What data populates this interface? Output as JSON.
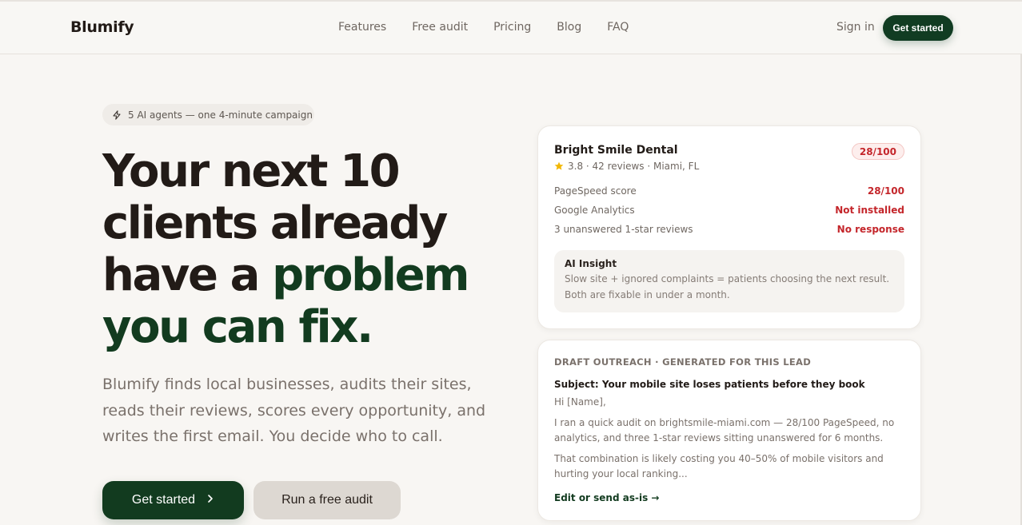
{
  "nav": {
    "logo": "Blumify",
    "links": [
      "Features",
      "Free audit",
      "Pricing",
      "Blog",
      "FAQ"
    ],
    "sign_in": "Sign in",
    "cta": "Get started"
  },
  "hero": {
    "badge": "5 AI agents — one 4-minute campaign",
    "headline_line1": "Your next 10",
    "headline_line2": "clients already",
    "headline_line3a": "have a ",
    "headline_line3b": "problem",
    "headline_line4": "you can fix.",
    "subcopy": "Blumify finds local businesses, audits their sites, reads their reviews, scores every opportunity, and writes the first email. You decide who to call.",
    "primary_button": "Get started",
    "secondary_button": "Run a free audit"
  },
  "lead_card": {
    "name": "Bright Smile Dental",
    "score": "28/100",
    "meta": "3.8 · 42 reviews · Miami, FL",
    "metrics": [
      {
        "label": "PageSpeed score",
        "value": "28/100"
      },
      {
        "label": "Google Analytics",
        "value": "Not installed"
      },
      {
        "label": "3 unanswered 1-star reviews",
        "value": "No response"
      }
    ],
    "insight_title": "AI Insight",
    "insight_text": "Slow site + ignored complaints = patients choosing the next result. Both are fixable in under a month."
  },
  "draft_card": {
    "heading": "DRAFT OUTREACH · GENERATED FOR THIS LEAD",
    "subject": "Subject: Your mobile site loses patients before they book",
    "greeting": "Hi [Name],",
    "para1": "I ran a quick audit on brightsmile-miami.com — 28/100 PageSpeed, no analytics, and three 1-star reviews sitting unanswered for 6 months.",
    "para2": "That combination is likely costing you 40–50% of mobile visitors and hurting your local ranking...",
    "action": "Edit or send as-is →"
  },
  "colors": {
    "brand_green": "#123b1f",
    "alert_red": "#c4262b",
    "background": "#f8f6f3"
  }
}
